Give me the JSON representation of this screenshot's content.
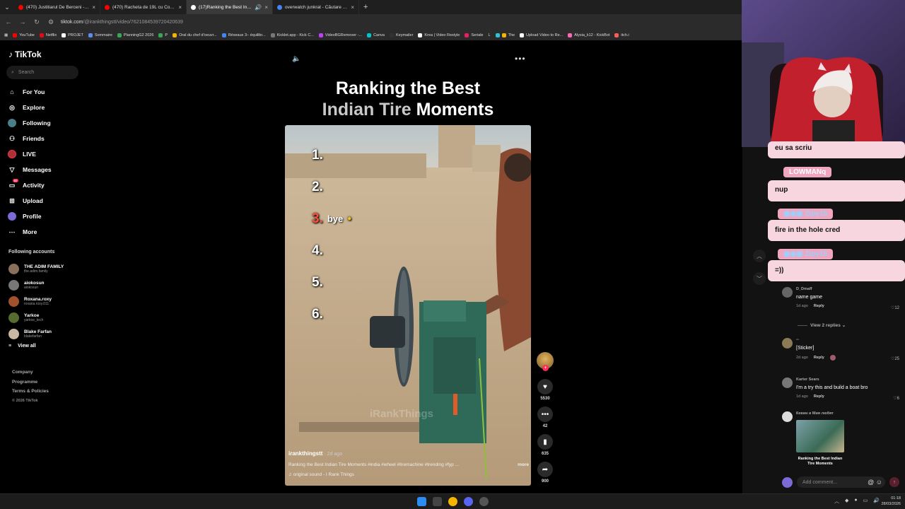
{
  "browser": {
    "tabs": [
      {
        "title": "(470) Justitiarul De Berceni - Yo",
        "favicon": "youtube-icon",
        "color": "#ff0000"
      },
      {
        "title": "(470) Racheta de 19L cu Coca C",
        "favicon": "youtube-icon",
        "color": "#ff0000"
      },
      {
        "title": "(17)Ranking the Best Indian",
        "favicon": "tiktok-icon",
        "color": "#ffffff",
        "active": true
      },
      {
        "title": "overwatch junkrat - Căutare Go",
        "favicon": "google-icon",
        "color": "#4285f4"
      }
    ],
    "new_tab": "+",
    "url_host": "tiktok.com",
    "url_path": "/@irankthingstt/video/7621084539720420639",
    "bookmarks": [
      "YouTube",
      "Netflix",
      "PROJET",
      "Sommaire",
      "PlanningG2 2026",
      "P",
      "Oral du chef d'oeuvr...",
      "Réseaux 3– équilibr...",
      "Kicklet.app - Kick C...",
      "VideoBGRemover -...",
      "Canva",
      "Keymailer",
      "Krea | Video Restyle",
      "Seriale",
      "L",
      "The",
      "Upload Video to Re...",
      "Alysia_k12 - KickBot",
      "itch.i"
    ]
  },
  "tiktok": {
    "logo": "TikTok",
    "search_placeholder": "Search",
    "nav": [
      {
        "label": "For You",
        "icon": "home-icon"
      },
      {
        "label": "Explore",
        "icon": "compass-icon"
      },
      {
        "label": "Following",
        "icon": "following-icon"
      },
      {
        "label": "Friends",
        "icon": "friends-icon"
      },
      {
        "label": "LIVE",
        "icon": "live-icon"
      },
      {
        "label": "Messages",
        "icon": "messages-icon"
      },
      {
        "label": "Activity",
        "icon": "activity-icon",
        "badge": "57"
      },
      {
        "label": "Upload",
        "icon": "upload-icon"
      },
      {
        "label": "Profile",
        "icon": "profile-icon"
      },
      {
        "label": "More",
        "icon": "more-icon"
      }
    ],
    "following_title": "Following accounts",
    "following": [
      {
        "name": "THE ADIM FAMILY",
        "handle": "the.adim.family",
        "color": "#8a6f5c"
      },
      {
        "name": "aiokosun",
        "handle": "aiokosun",
        "color": "#777"
      },
      {
        "name": "Roxana.roxy",
        "handle": "roxana.roxy.011",
        "color": "#a0522d"
      },
      {
        "name": "Yarkoe",
        "handle": "yarkoe_tech",
        "color": "#556b2f"
      },
      {
        "name": "Blake Farfan",
        "handle": "blakefarfan",
        "color": "#c9b8a3"
      }
    ],
    "view_all": "View all",
    "footer": [
      "Company",
      "Programme",
      "Terms & Policies"
    ],
    "copyright": "© 2026 TikTok"
  },
  "video": {
    "title_line1": "Ranking the Best",
    "title_line2_grey": "Indian Tire",
    "title_line2_white": " Moments",
    "ranks": [
      "1.",
      "2.",
      "3.",
      "4.",
      "5.",
      "6."
    ],
    "rank3_note": "bye",
    "watermark": "iRankThings",
    "author": "irankthingstt",
    "ago": " · 2d ago",
    "description": "Ranking the Best Indian Tire Moments #india #wheel #tiremachine #trending #fyp ...",
    "more": "more",
    "sound": "original sound - I Rank Things",
    "likes": "5530",
    "comments": "42",
    "saves": "635",
    "shares": "900"
  },
  "chat": [
    {
      "type": "msg",
      "text": "eu sa scriu"
    },
    {
      "type": "name",
      "text": "LOWMANq"
    },
    {
      "type": "msg",
      "text": "nup"
    },
    {
      "type": "name",
      "text": "Zipy15"
    },
    {
      "type": "msg",
      "text": "fire in the hole cred"
    },
    {
      "type": "name",
      "text": "Zipy15"
    },
    {
      "type": "msg",
      "text": "=))"
    }
  ],
  "comments": [
    {
      "user": "D_Dmaff",
      "text": "name game",
      "time": "1d ago",
      "reply": "Reply",
      "likes": "12",
      "replies": "View 2 replies"
    },
    {
      "user": "",
      "text": "[Sticker]",
      "time": "2d ago",
      "reply": "Reply",
      "likes": "25"
    },
    {
      "user": "Karter Sears",
      "text": "I'm a try this and build a boat bro",
      "time": "1d ago",
      "reply": "Reply",
      "likes": "6"
    },
    {
      "user": "Кевин и Мия любят",
      "sticker_caption": "Ranking the Best Indian Tire Moments"
    }
  ],
  "comment_input_placeholder": "Add comment...",
  "taskbar": {
    "time": "01:18",
    "date": "28/03/2026"
  }
}
